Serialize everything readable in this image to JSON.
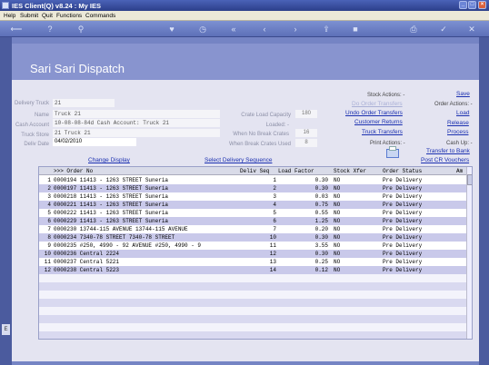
{
  "window": {
    "title": "IES Client(Q) v8.24 : My IES"
  },
  "menu": [
    "Help",
    "Submit",
    "Quit",
    "Functions",
    "Commands"
  ],
  "page": {
    "title": "Sari Sari Dispatch"
  },
  "form": {
    "delivery_truck": {
      "label": "Delivery Truck",
      "value": "21"
    },
    "name": {
      "label": "Name",
      "value": "Truck 21"
    },
    "cash_account": {
      "label": "Cash Account",
      "value": "10-08-08-84d Cash Account: Truck 21"
    },
    "truck_store": {
      "label": "Truck Store",
      "value": "21 Truck 21"
    },
    "deliv_date": {
      "label": "Deliv Date",
      "value": "04/02/2010"
    },
    "crate_load_capacity": {
      "label": "Crate Load Capacity",
      "value": "180"
    },
    "loaded": {
      "label": "Loaded: -"
    },
    "when_no_break_crates": {
      "label": "When No Break Crates",
      "value": "16"
    },
    "when_break_crates_used": {
      "label": "When Break Crates Used",
      "value": "8"
    }
  },
  "stock_actions": {
    "label": "Stock Actions: -",
    "items": [
      "Do Order Transfers",
      "Undo Order Transfers",
      "Customer Returns",
      "Truck Transfers"
    ]
  },
  "print_actions": {
    "label": "Print Actions: -"
  },
  "order_actions": {
    "save": "Save",
    "label": "Order Actions: -",
    "items": [
      "Load",
      "Release",
      "Process"
    ]
  },
  "cash_up": {
    "label": "Cash Up: -",
    "items": [
      "Transfer to Bank",
      "Post CR Vouchers"
    ]
  },
  "links": {
    "change_display": "Change Display",
    "select_delivery_sequence": "Select Delivery Sequence"
  },
  "table": {
    "headers": {
      "order_no": ">>> Order No",
      "deliv_seq": "Deliv Seq",
      "load_factor": "Load Factor",
      "stock_xfer": "Stock Xfer",
      "order_status": "Order Status",
      "am": "Am"
    },
    "rows": [
      {
        "n": "1",
        "order": "0000194 11413 - 1263 STREET Suneria",
        "seq": "1",
        "load": "0.30",
        "xfer": "NO",
        "status": "Pre Delivery"
      },
      {
        "n": "2",
        "order": "0000197 11413 - 1263 STREET Suneria",
        "seq": "2",
        "load": "0.30",
        "xfer": "NO",
        "status": "Pre Delivery"
      },
      {
        "n": "3",
        "order": "0000218 11413 - 1263 STREET Suneria",
        "seq": "3",
        "load": "0.03",
        "xfer": "NO",
        "status": "Pre Delivery"
      },
      {
        "n": "4",
        "order": "0000221 11413 - 1263 STREET Suneria",
        "seq": "4",
        "load": "0.75",
        "xfer": "NO",
        "status": "Pre Delivery"
      },
      {
        "n": "5",
        "order": "0000222 11413 - 1263 STREET Suneria",
        "seq": "5",
        "load": "0.55",
        "xfer": "NO",
        "status": "Pre Delivery"
      },
      {
        "n": "6",
        "order": "0000229 11413 - 1263 STREET Suneria",
        "seq": "6",
        "load": "1.25",
        "xfer": "NO",
        "status": "Pre Delivery"
      },
      {
        "n": "7",
        "order": "0000230 13744-115 AVENUE 13744-115 AVENUE",
        "seq": "7",
        "load": "0.20",
        "xfer": "NO",
        "status": "Pre Delivery"
      },
      {
        "n": "8",
        "order": "0000234 7340-78 STREET 7340-78 STREET",
        "seq": "10",
        "load": "0.30",
        "xfer": "NO",
        "status": "Pre Delivery"
      },
      {
        "n": "9",
        "order": "0000235 #250, 4990 - 92 AVENUE #250, 4990 - 9",
        "seq": "11",
        "load": "3.55",
        "xfer": "NO",
        "status": "Pre Delivery"
      },
      {
        "n": "10",
        "order": "0000236 Central 2224",
        "seq": "12",
        "load": "0.30",
        "xfer": "NO",
        "status": "Pre Delivery"
      },
      {
        "n": "11",
        "order": "0000237 Central 5221",
        "seq": "13",
        "load": "0.25",
        "xfer": "NO",
        "status": "Pre Delivery"
      },
      {
        "n": "12",
        "order": "0000238 Central 5223",
        "seq": "14",
        "load": "0.12",
        "xfer": "NO",
        "status": "Pre Delivery"
      }
    ]
  },
  "icons": [
    "back-arrow-icon",
    "help-icon",
    "search-icon",
    "favorite-icon",
    "history-icon",
    "rewind-icon",
    "first-icon",
    "next-icon",
    "upload-icon",
    "stop-icon",
    "print-icon",
    "ok-icon",
    "cancel-icon"
  ],
  "colors": {
    "accent": "#3b4a8c",
    "link": "#1a2fb0",
    "row_alt": "#c9c9ea"
  }
}
